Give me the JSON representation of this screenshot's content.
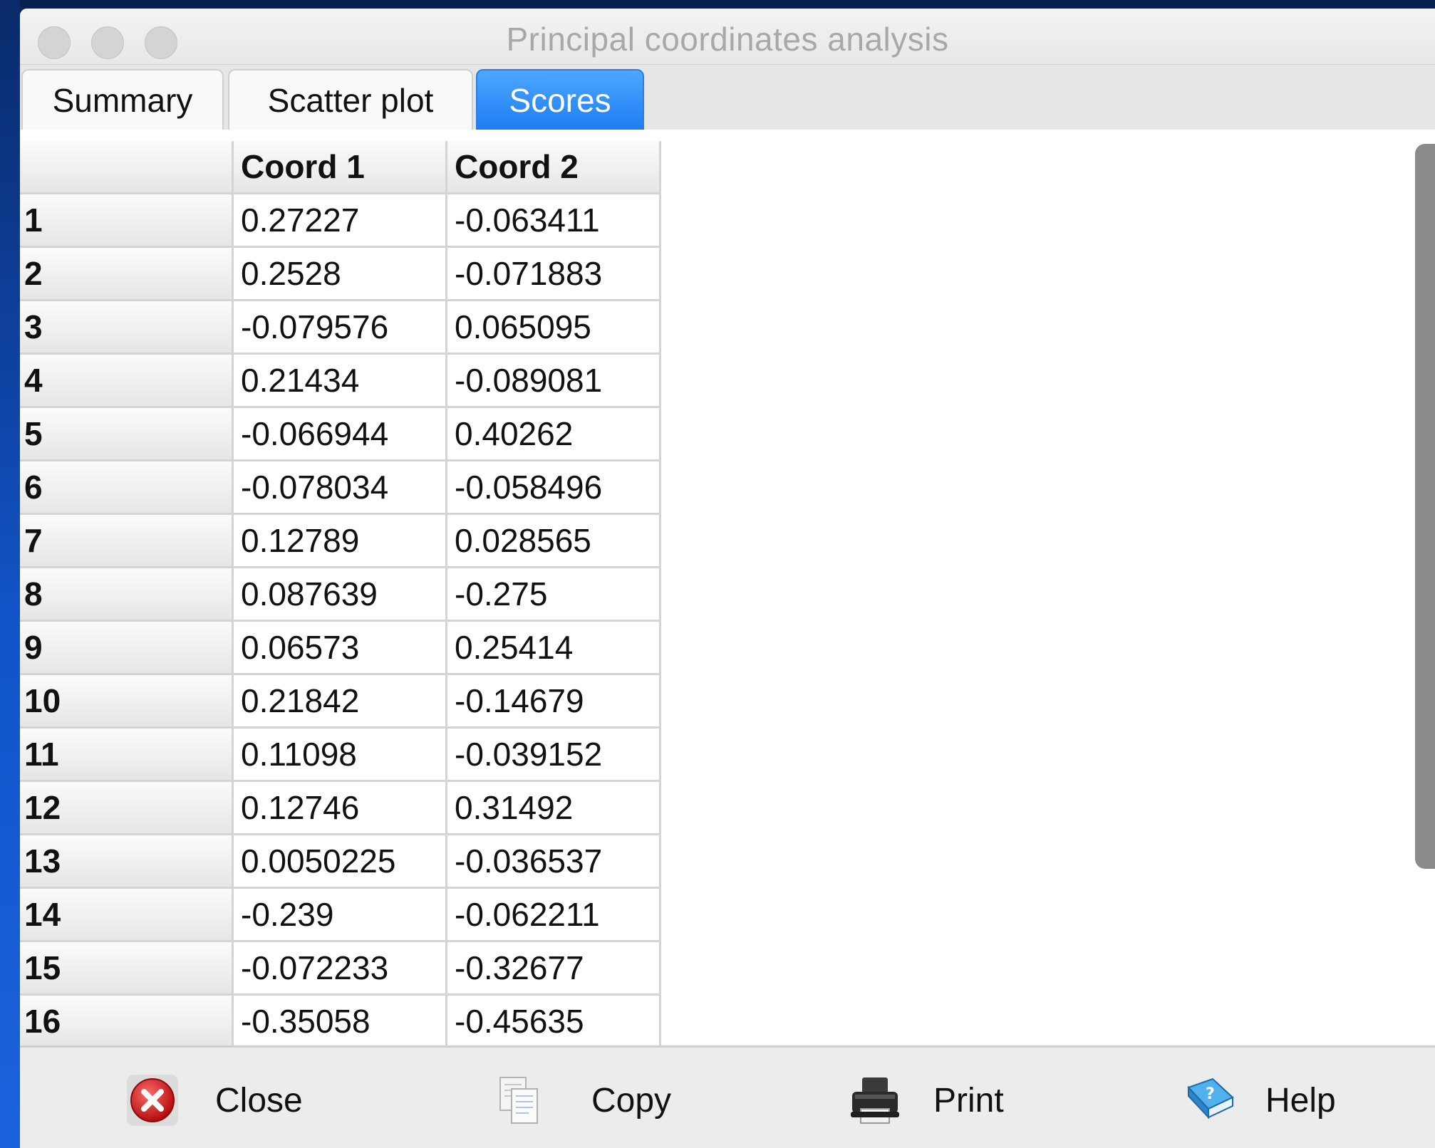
{
  "window": {
    "title": "Principal coordinates analysis"
  },
  "tabs": [
    {
      "label": "Summary",
      "active": false
    },
    {
      "label": "Scatter plot",
      "active": false
    },
    {
      "label": "Scores",
      "active": true
    }
  ],
  "table": {
    "columns": [
      "Coord 1",
      "Coord 2"
    ],
    "rows": [
      {
        "id": "1",
        "c1": "0.27227",
        "c2": "-0.063411"
      },
      {
        "id": "2",
        "c1": "0.2528",
        "c2": "-0.071883"
      },
      {
        "id": "3",
        "c1": "-0.079576",
        "c2": "0.065095"
      },
      {
        "id": "4",
        "c1": "0.21434",
        "c2": "-0.089081"
      },
      {
        "id": "5",
        "c1": "-0.066944",
        "c2": "0.40262"
      },
      {
        "id": "6",
        "c1": "-0.078034",
        "c2": "-0.058496"
      },
      {
        "id": "7",
        "c1": "0.12789",
        "c2": "0.028565"
      },
      {
        "id": "8",
        "c1": "0.087639",
        "c2": "-0.275"
      },
      {
        "id": "9",
        "c1": "0.06573",
        "c2": "0.25414"
      },
      {
        "id": "10",
        "c1": "0.21842",
        "c2": "-0.14679"
      },
      {
        "id": "11",
        "c1": "0.11098",
        "c2": "-0.039152"
      },
      {
        "id": "12",
        "c1": "0.12746",
        "c2": "0.31492"
      },
      {
        "id": "13",
        "c1": "0.0050225",
        "c2": "-0.036537"
      },
      {
        "id": "14",
        "c1": "-0.239",
        "c2": "-0.062211"
      },
      {
        "id": "15",
        "c1": "-0.072233",
        "c2": "-0.32677"
      },
      {
        "id": "16",
        "c1": "-0.35058",
        "c2": "-0.45635"
      }
    ]
  },
  "footer": {
    "close_label": "Close",
    "copy_label": "Copy",
    "print_label": "Print",
    "help_label": "Help"
  },
  "icons": {
    "close": "close-icon",
    "copy": "copy-icon",
    "print": "printer-icon",
    "help": "help-book-icon"
  },
  "colors": {
    "active_tab": "#1d7cf2",
    "close_icon": "#d01818"
  }
}
